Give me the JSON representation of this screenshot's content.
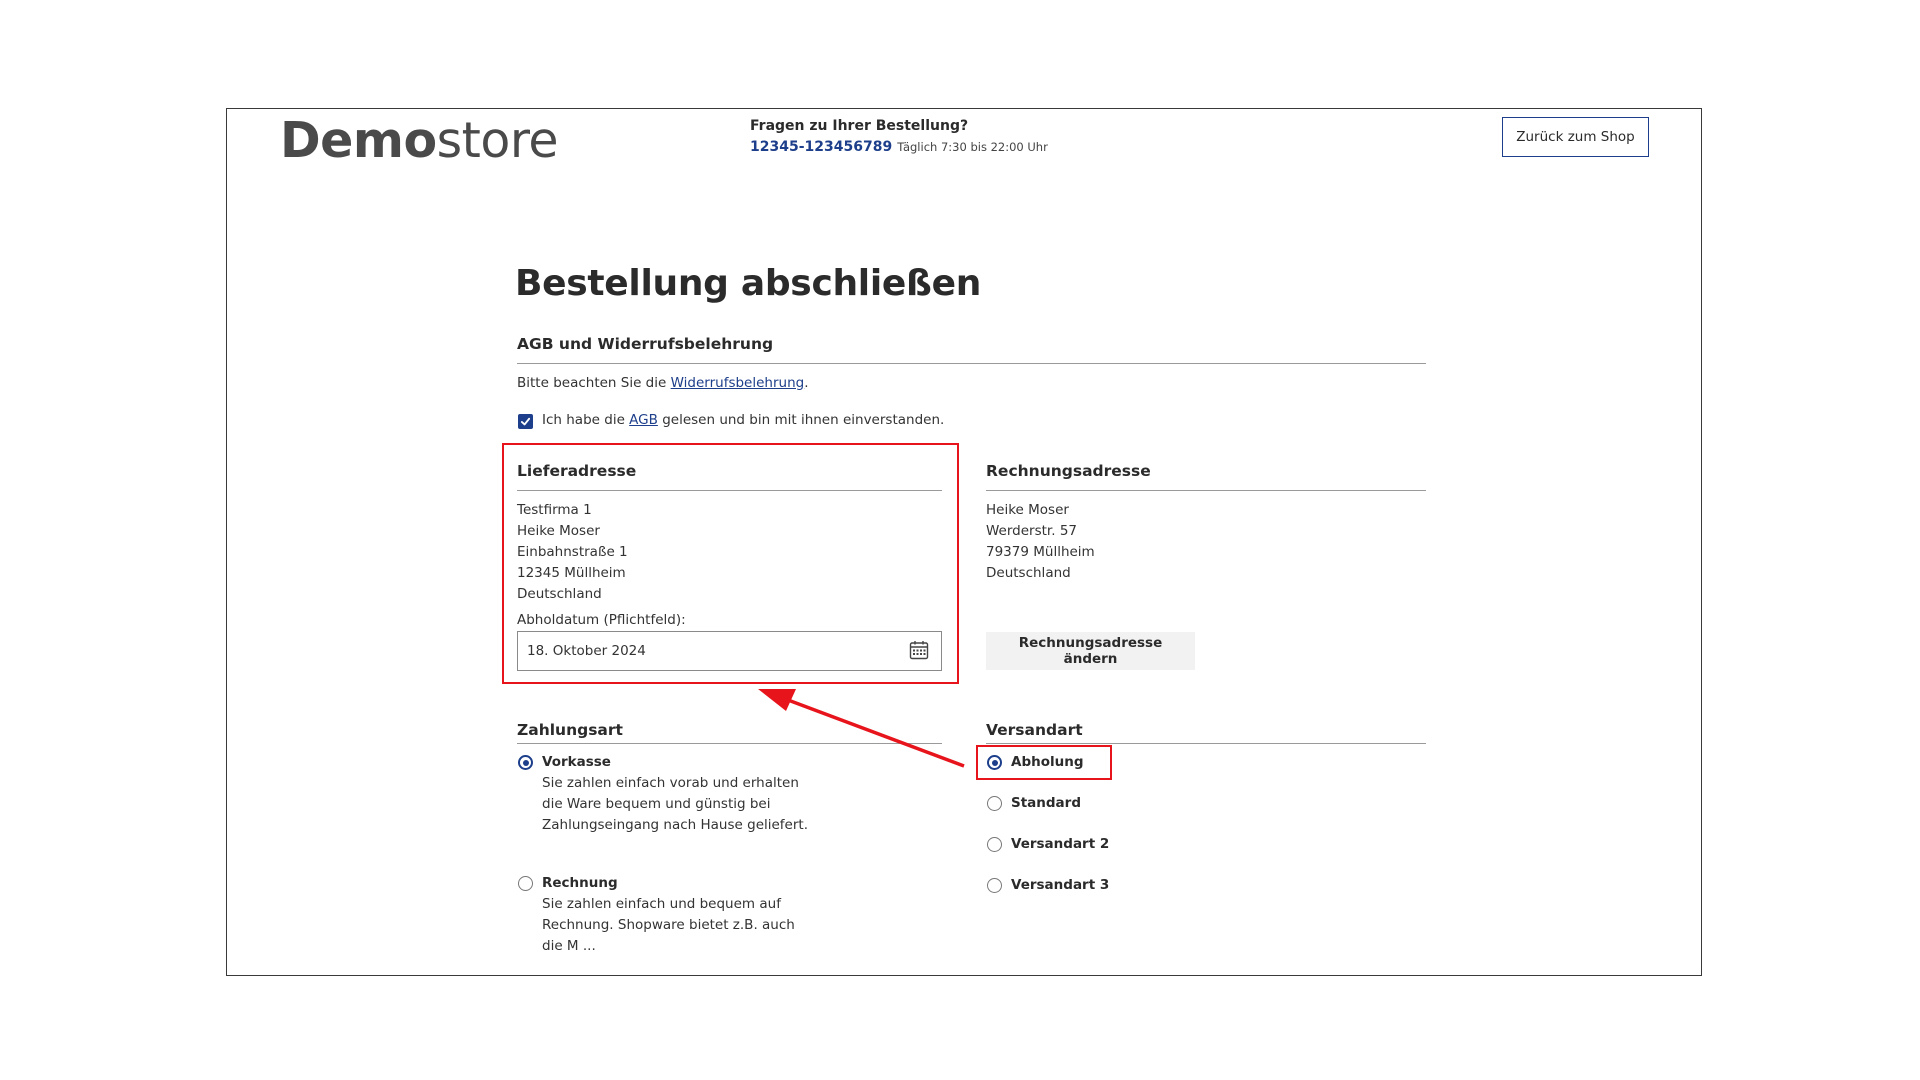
{
  "header": {
    "logo_bold": "Demo",
    "logo_light": "store",
    "hotline_question": "Fragen zu Ihrer Bestellung?",
    "hotline_phone": "12345-123456789",
    "hotline_hours": "Täglich 7:30 bis 22:00 Uhr",
    "back_button": "Zurück zum Shop"
  },
  "page": {
    "title": "Bestellung abschließen"
  },
  "terms": {
    "title": "AGB und Widerrufsbelehrung",
    "notice_prefix": "Bitte beachten Sie die ",
    "notice_link": "Widerrufsbelehrung",
    "notice_suffix": ".",
    "agb_checked": true,
    "agb_prefix": "Ich habe die ",
    "agb_link": "AGB",
    "agb_suffix": " gelesen und bin mit ihnen einverstanden."
  },
  "shipping_address": {
    "title": "Lieferadresse",
    "lines": [
      "Testfirma 1",
      "Heike Moser",
      "Einbahnstraße 1",
      "12345 Müllheim",
      "Deutschland"
    ],
    "pickup_label": "Abholdatum (Pflichtfeld):",
    "pickup_value": "18. Oktober 2024"
  },
  "billing_address": {
    "title": "Rechnungsadresse",
    "lines": [
      "Heike Moser",
      "Werderstr. 57",
      "79379 Müllheim",
      "Deutschland"
    ],
    "change_button": "Rechnungsadresse ändern"
  },
  "payment": {
    "title": "Zahlungsart",
    "options": [
      {
        "label": "Vorkasse",
        "selected": true,
        "description": [
          "Sie zahlen einfach vorab und erhalten",
          "die Ware bequem und günstig bei",
          "Zahlungseingang nach Hause geliefert."
        ]
      },
      {
        "label": "Rechnung",
        "selected": false,
        "description": [
          "Sie zahlen einfach und bequem auf",
          "Rechnung. Shopware bietet z.B. auch",
          "die M ..."
        ]
      }
    ]
  },
  "shipping_method": {
    "title": "Versandart",
    "options": [
      {
        "label": "Abholung",
        "selected": true
      },
      {
        "label": "Standard",
        "selected": false
      },
      {
        "label": "Versandart 2",
        "selected": false
      },
      {
        "label": "Versandart 3",
        "selected": false
      }
    ]
  },
  "colors": {
    "accent": "#1d3e8a",
    "highlight": "#e8141b",
    "text": "#2b2b2b",
    "rule": "#9a9a9a"
  },
  "icons": {
    "checkbox": "check-icon",
    "date": "calendar-icon"
  }
}
